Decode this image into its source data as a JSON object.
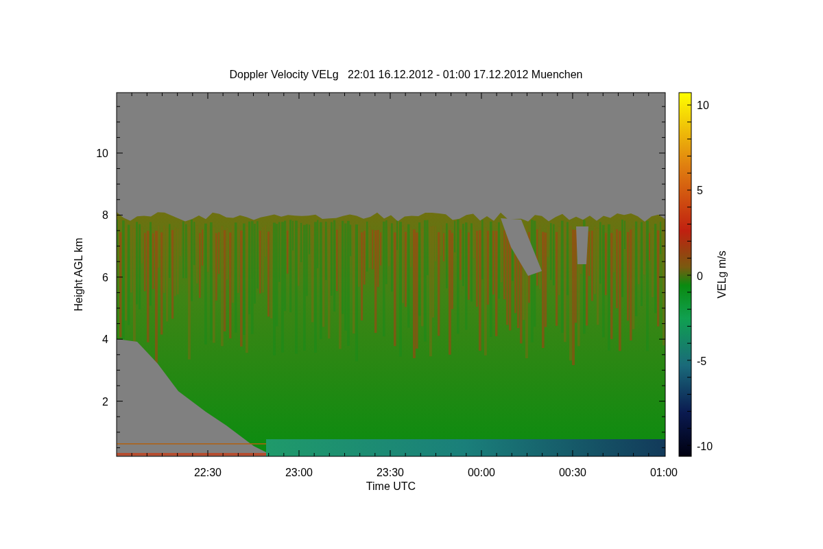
{
  "title": "Doppler Velocity VELg   22:01 16.12.2012 - 01:00 17.12.2012 Muenchen",
  "x_axis": {
    "label": "Time UTC",
    "ticks": [
      "22:30",
      "23:00",
      "23:30",
      "00:00",
      "00:30",
      "01:00"
    ]
  },
  "y_axis": {
    "label": "Height AGL km",
    "ticks": [
      "10",
      "8",
      "6",
      "4",
      "2"
    ]
  },
  "colorbar": {
    "label": "VELg m/s",
    "ticks": [
      "10",
      "5",
      "0",
      "-5",
      "-10"
    ]
  }
}
